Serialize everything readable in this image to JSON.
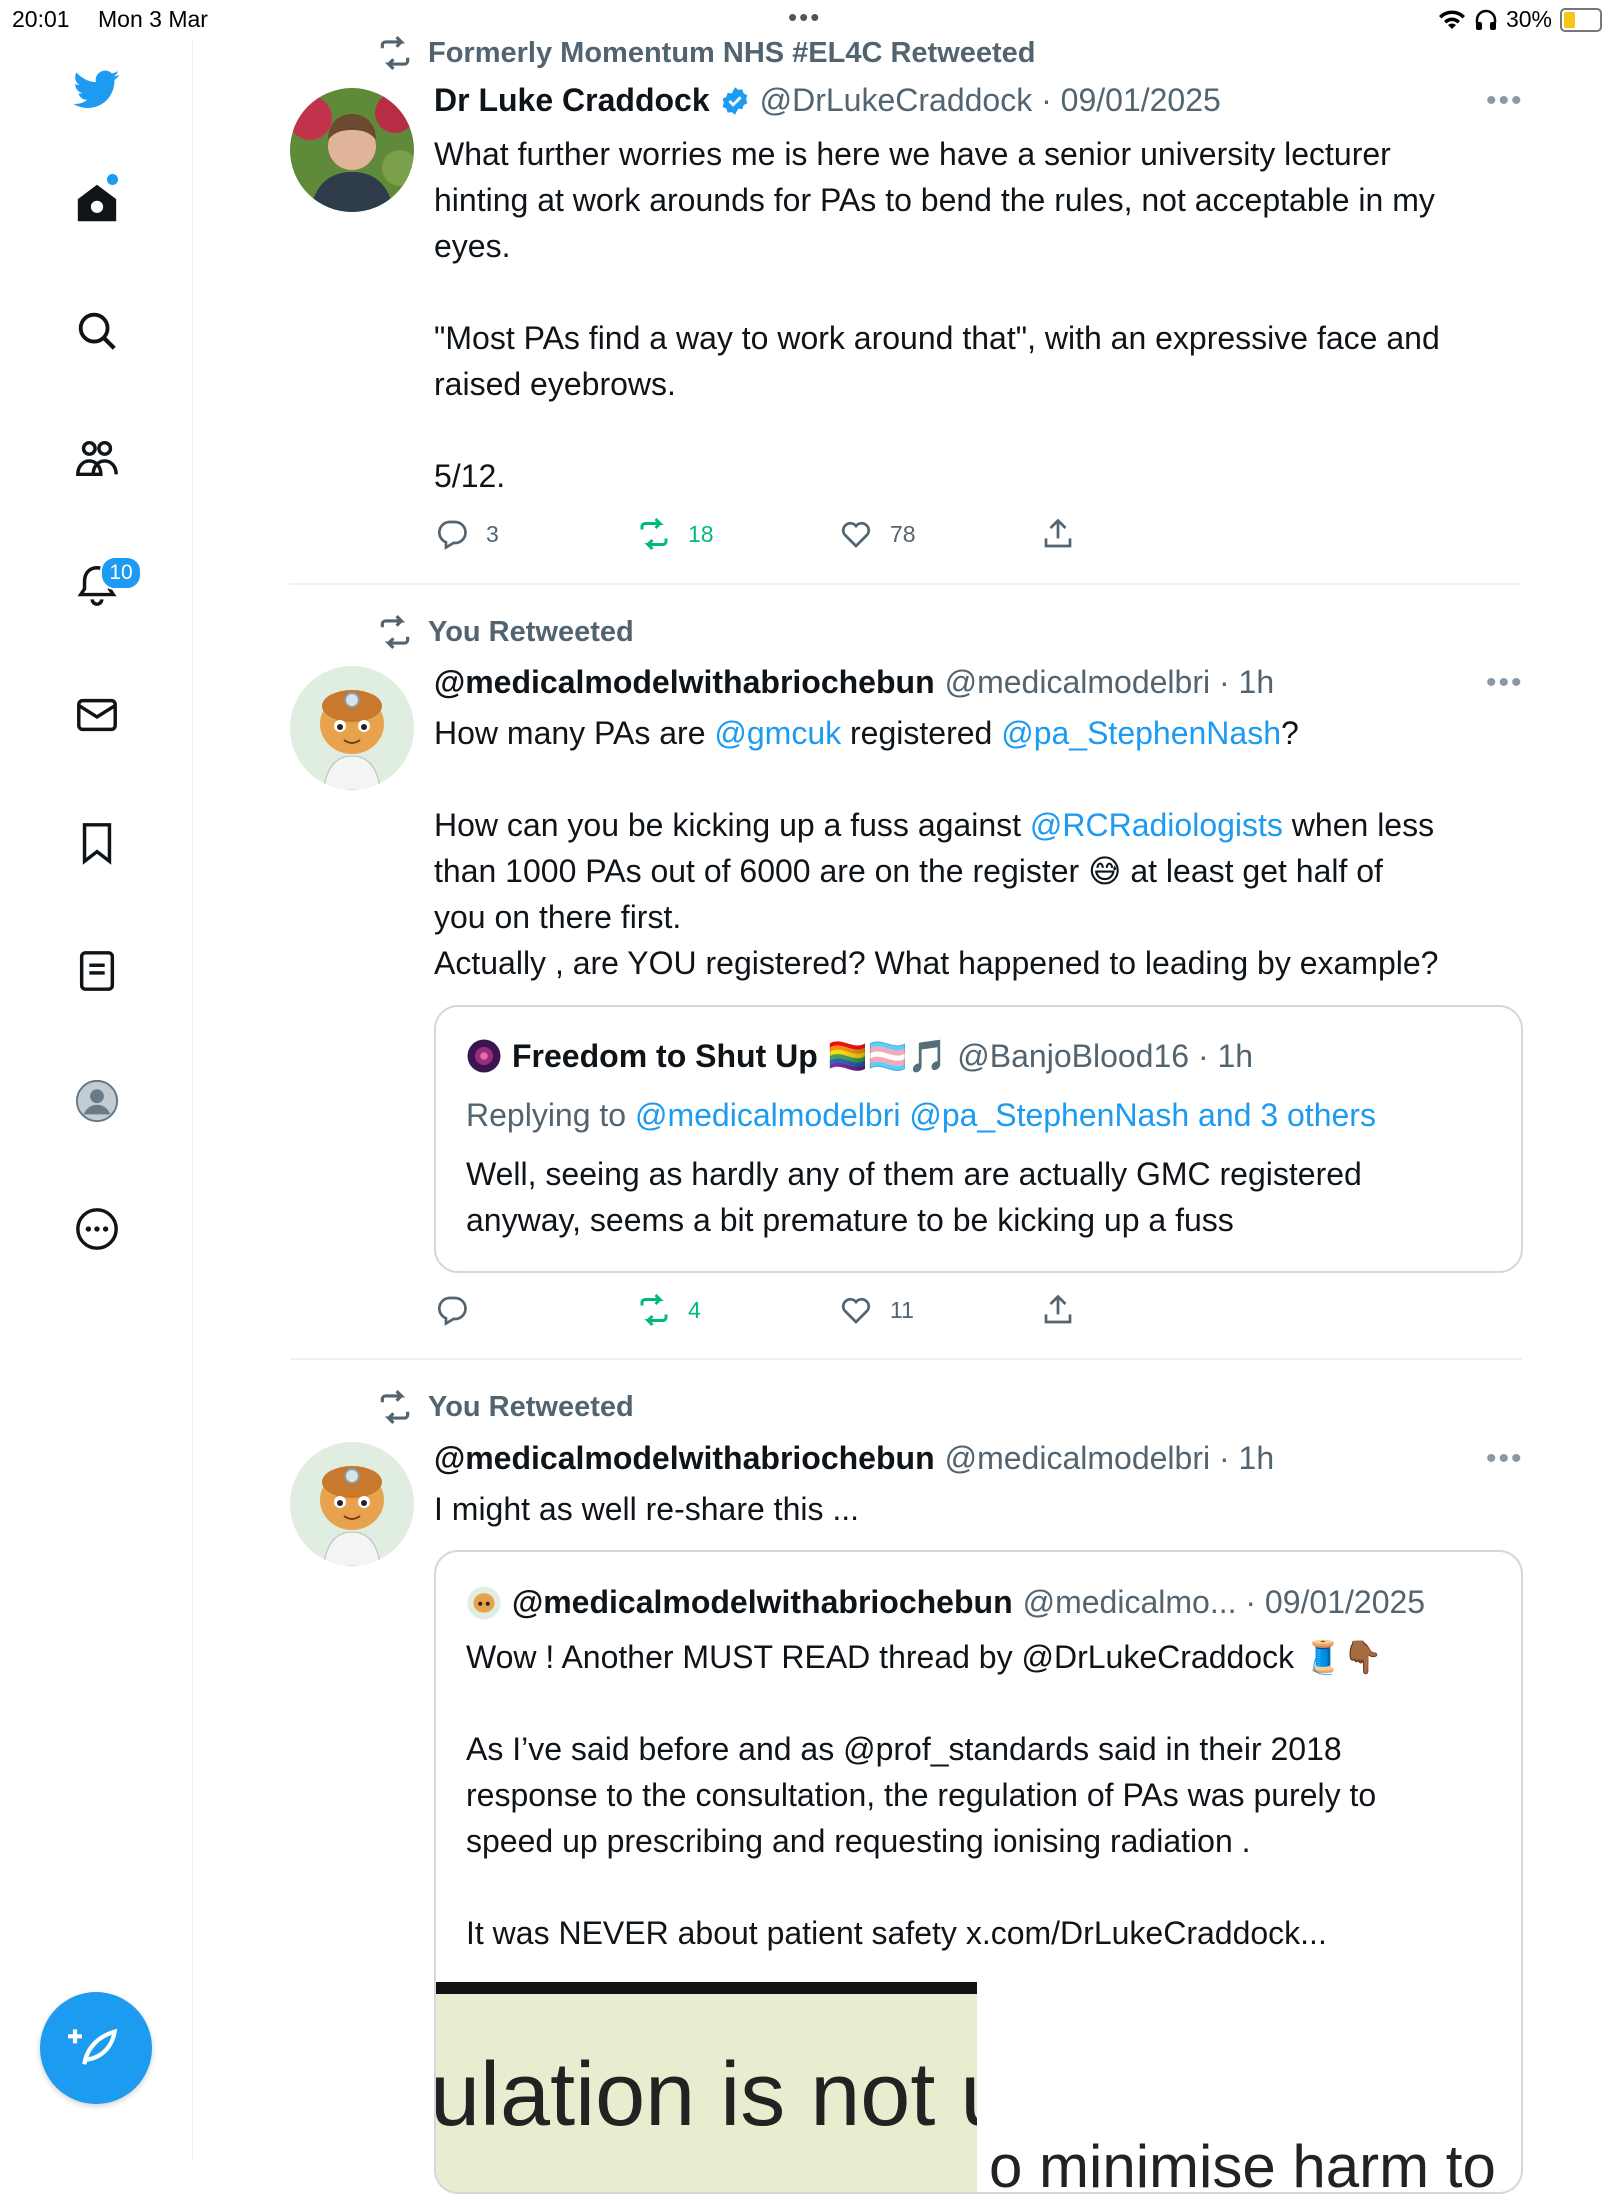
{
  "status_bar": {
    "time": "20:01",
    "date": "Mon 3 Mar",
    "battery": "30%"
  },
  "sidebar": {
    "notifications_badge": "10"
  },
  "tweets": [
    {
      "retweet_label": "Formerly Momentum NHS #EL4C Retweeted",
      "name": "Dr Luke Craddock",
      "verified": true,
      "handle_time": "@DrLukeCraddock · 09/01/2025",
      "lines": [
        "What further worries me is here we have a senior university lecturer",
        "hinting at work arounds for PAs to bend the rules, not acceptable in my",
        "eyes.",
        "",
        "\"Most PAs find a way to work around that\", with an expressive face and",
        "raised eyebrows.",
        "",
        "5/12."
      ],
      "replies": "3",
      "retweets": "18",
      "likes": "78"
    },
    {
      "retweet_label": "You Retweeted",
      "name": "@medicalmodelwithabriochebun",
      "handle_time": "@medicalmodelbri · 1h",
      "text": {
        "p1_a": "How many PAs are ",
        "p1_m1": "@gmcuk",
        "p1_b": " registered ",
        "p1_m2": "@pa_StephenNash",
        "p1_c": "?",
        "p2_a": "How can you be kicking up a fuss against ",
        "p2_m": "@RCRadiologists",
        "p2_b": " when less",
        "p3_a": "than 1000 PAs out of 6000 are on the register ",
        "p3_emoji": "😅",
        "p3_b": " at least get half of",
        "p4": "you on there first.",
        "p5": "Actually , are YOU registered? What happened to leading by example?"
      },
      "quote": {
        "name": "Freedom to Shut Up",
        "emojis": "🏳️‍🌈🏳️‍⚧️🎵",
        "handle_time": "@BanjoBlood16 · 1h",
        "replying_prefix": "Replying to ",
        "replying_to": "@medicalmodelbri @pa_StephenNash and 3 others",
        "lines": [
          "Well, seeing as hardly any of them are actually GMC registered",
          "anyway, seems a bit premature to be kicking up a fuss"
        ]
      },
      "retweets": "4",
      "likes": "11"
    },
    {
      "retweet_label": "You Retweeted",
      "name": "@medicalmodelwithabriochebun",
      "handle_time": "@medicalmodelbri · 1h",
      "text": "I might as well re-share this ...",
      "quote": {
        "name": "@medicalmodelwithabriochebun",
        "handle_time": "@medicalmo... · 09/01/2025",
        "line1": "Wow ! Another MUST READ thread by @DrLukeCraddock 🧵👇🏾",
        "lines": [
          "As I’ve said before and as @prof_standards said in their 2018",
          "response to the consultation, the regulation of PAs was purely to",
          "speed up prescribing and requesting ionising radiation ."
        ],
        "line_last": "It was NEVER about patient safety x.com/DrLukeCraddock...",
        "image_text1": "ulation is not u",
        "image_text2": "o minimise harm to"
      }
    }
  ]
}
